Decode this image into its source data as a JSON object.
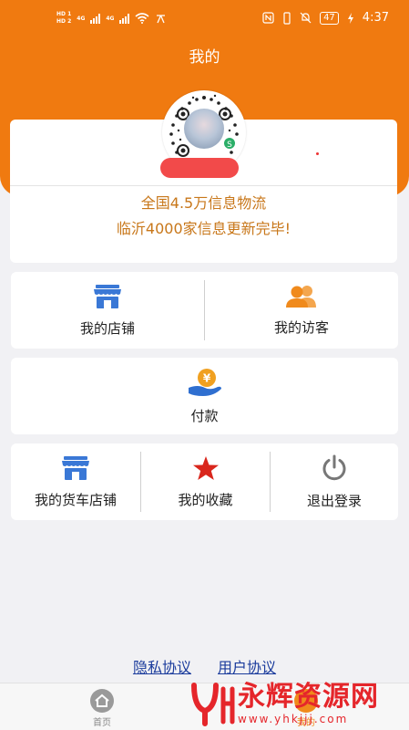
{
  "status_bar": {
    "hd_top": "HD 1",
    "hd_bottom": "HD 2",
    "net1": "4G",
    "net2": "4G",
    "battery": "47",
    "time": "4:37"
  },
  "header": {
    "title": "我的"
  },
  "profile": {
    "banner_line1": "全国4.5万信息物流",
    "banner_line2": "临沂4000家信息更新完毕!"
  },
  "menu_row1": [
    {
      "label": "我的店铺",
      "icon": "store-icon",
      "color": "#3a78d6"
    },
    {
      "label": "我的访客",
      "icon": "visitors-icon",
      "color": "#f08a1c"
    }
  ],
  "menu_row2": [
    {
      "label": "付款",
      "icon": "payment-icon",
      "color": "#f0a020"
    }
  ],
  "menu_row3": [
    {
      "label": "我的货车店铺",
      "icon": "truck-store-icon",
      "color": "#3a78d6"
    },
    {
      "label": "我的收藏",
      "icon": "star-icon",
      "color": "#d9261c"
    },
    {
      "label": "退出登录",
      "icon": "power-icon",
      "color": "#777777"
    }
  ],
  "legal": {
    "privacy": "隐私协议",
    "user": "用户协议"
  },
  "tabbar": {
    "home": "首页",
    "mine": "我的"
  },
  "watermark": {
    "title": "永辉资源网",
    "url": "www.yhkjjj.com"
  }
}
